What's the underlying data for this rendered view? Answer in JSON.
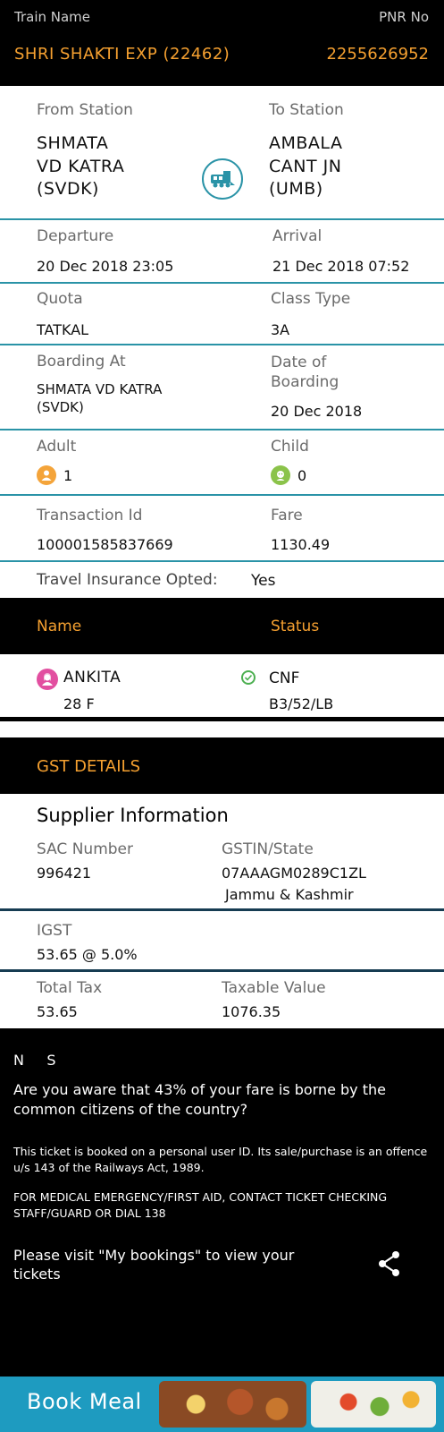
{
  "header": {
    "train_name_label": "Train Name",
    "pnr_label": "PNR No",
    "train_name": "SHRI SHAKTI EXP (22462)",
    "pnr_no": "2255626952"
  },
  "journey": {
    "from_label": "From Station",
    "to_label": "To Station",
    "from_station": "SHMATA\nVD KATRA\n(SVDK)",
    "to_station": "AMBALA\nCANT JN\n(UMB)",
    "departure_label": "Departure",
    "arrival_label": "Arrival",
    "departure": "20 Dec 2018  23:05",
    "arrival": "21 Dec 2018  07:52",
    "quota_label": "Quota",
    "class_label": "Class Type",
    "quota": "TATKAL",
    "class": "3A",
    "boarding_label": "Boarding At",
    "date_boarding_label": "Date of\nBoarding",
    "boarding_at": "SHMATA VD KATRA\n(SVDK)",
    "date_boarding": "20 Dec 2018",
    "adult_label": "Adult",
    "child_label": "Child",
    "adult_count": "1",
    "child_count": "0",
    "txn_label": "Transaction Id",
    "fare_label": "Fare",
    "txn_id": "100001585837669",
    "fare": "1130.49",
    "insurance_label": "Travel Insurance Opted:",
    "insurance_value": "Yes"
  },
  "passengers": {
    "name_header": "Name",
    "status_header": "Status",
    "list": [
      {
        "name": "ANKITA",
        "age_gender": "28 F",
        "status": "CNF",
        "berth": "B3/52/LB"
      }
    ]
  },
  "gst": {
    "title": "GST DETAILS",
    "supplier_heading": "Supplier Information",
    "sac_label": "SAC Number",
    "sac_value": "996421",
    "gstin_label": "GSTIN/State",
    "gstin_value": "07AAAGM0289C1ZL",
    "state_value": "Jammu & Kashmir",
    "igst_label": "IGST",
    "igst_value": "53.65 @ 5.0%",
    "total_tax_label": "Total Tax",
    "total_tax_value": "53.65",
    "taxable_label": "Taxable Value",
    "taxable_value": "1076.35"
  },
  "notes": {
    "ns": "N     S",
    "awareness": "Are you aware that 43% of your fare is borne by the common citizens of the country?",
    "legal": "This ticket is booked on a personal user ID. Its sale/purchase is an offence u/s 143 of the Railways Act, 1989.",
    "medical": "FOR MEDICAL EMERGENCY/FIRST AID, CONTACT TICKET CHECKING STAFF/GUARD OR DIAL 138",
    "visit": "Please visit \"My bookings\" to view your tickets"
  },
  "footer": {
    "book_meal": "Book Meal"
  },
  "icons": {
    "train": "train-icon",
    "adult": "adult-icon",
    "child": "child-icon",
    "passenger": "passenger-icon",
    "check": "check-circle-icon",
    "share": "share-icon"
  },
  "colors": {
    "accent_orange": "#f5a030",
    "teal": "#2a93a7",
    "black": "#000000"
  }
}
